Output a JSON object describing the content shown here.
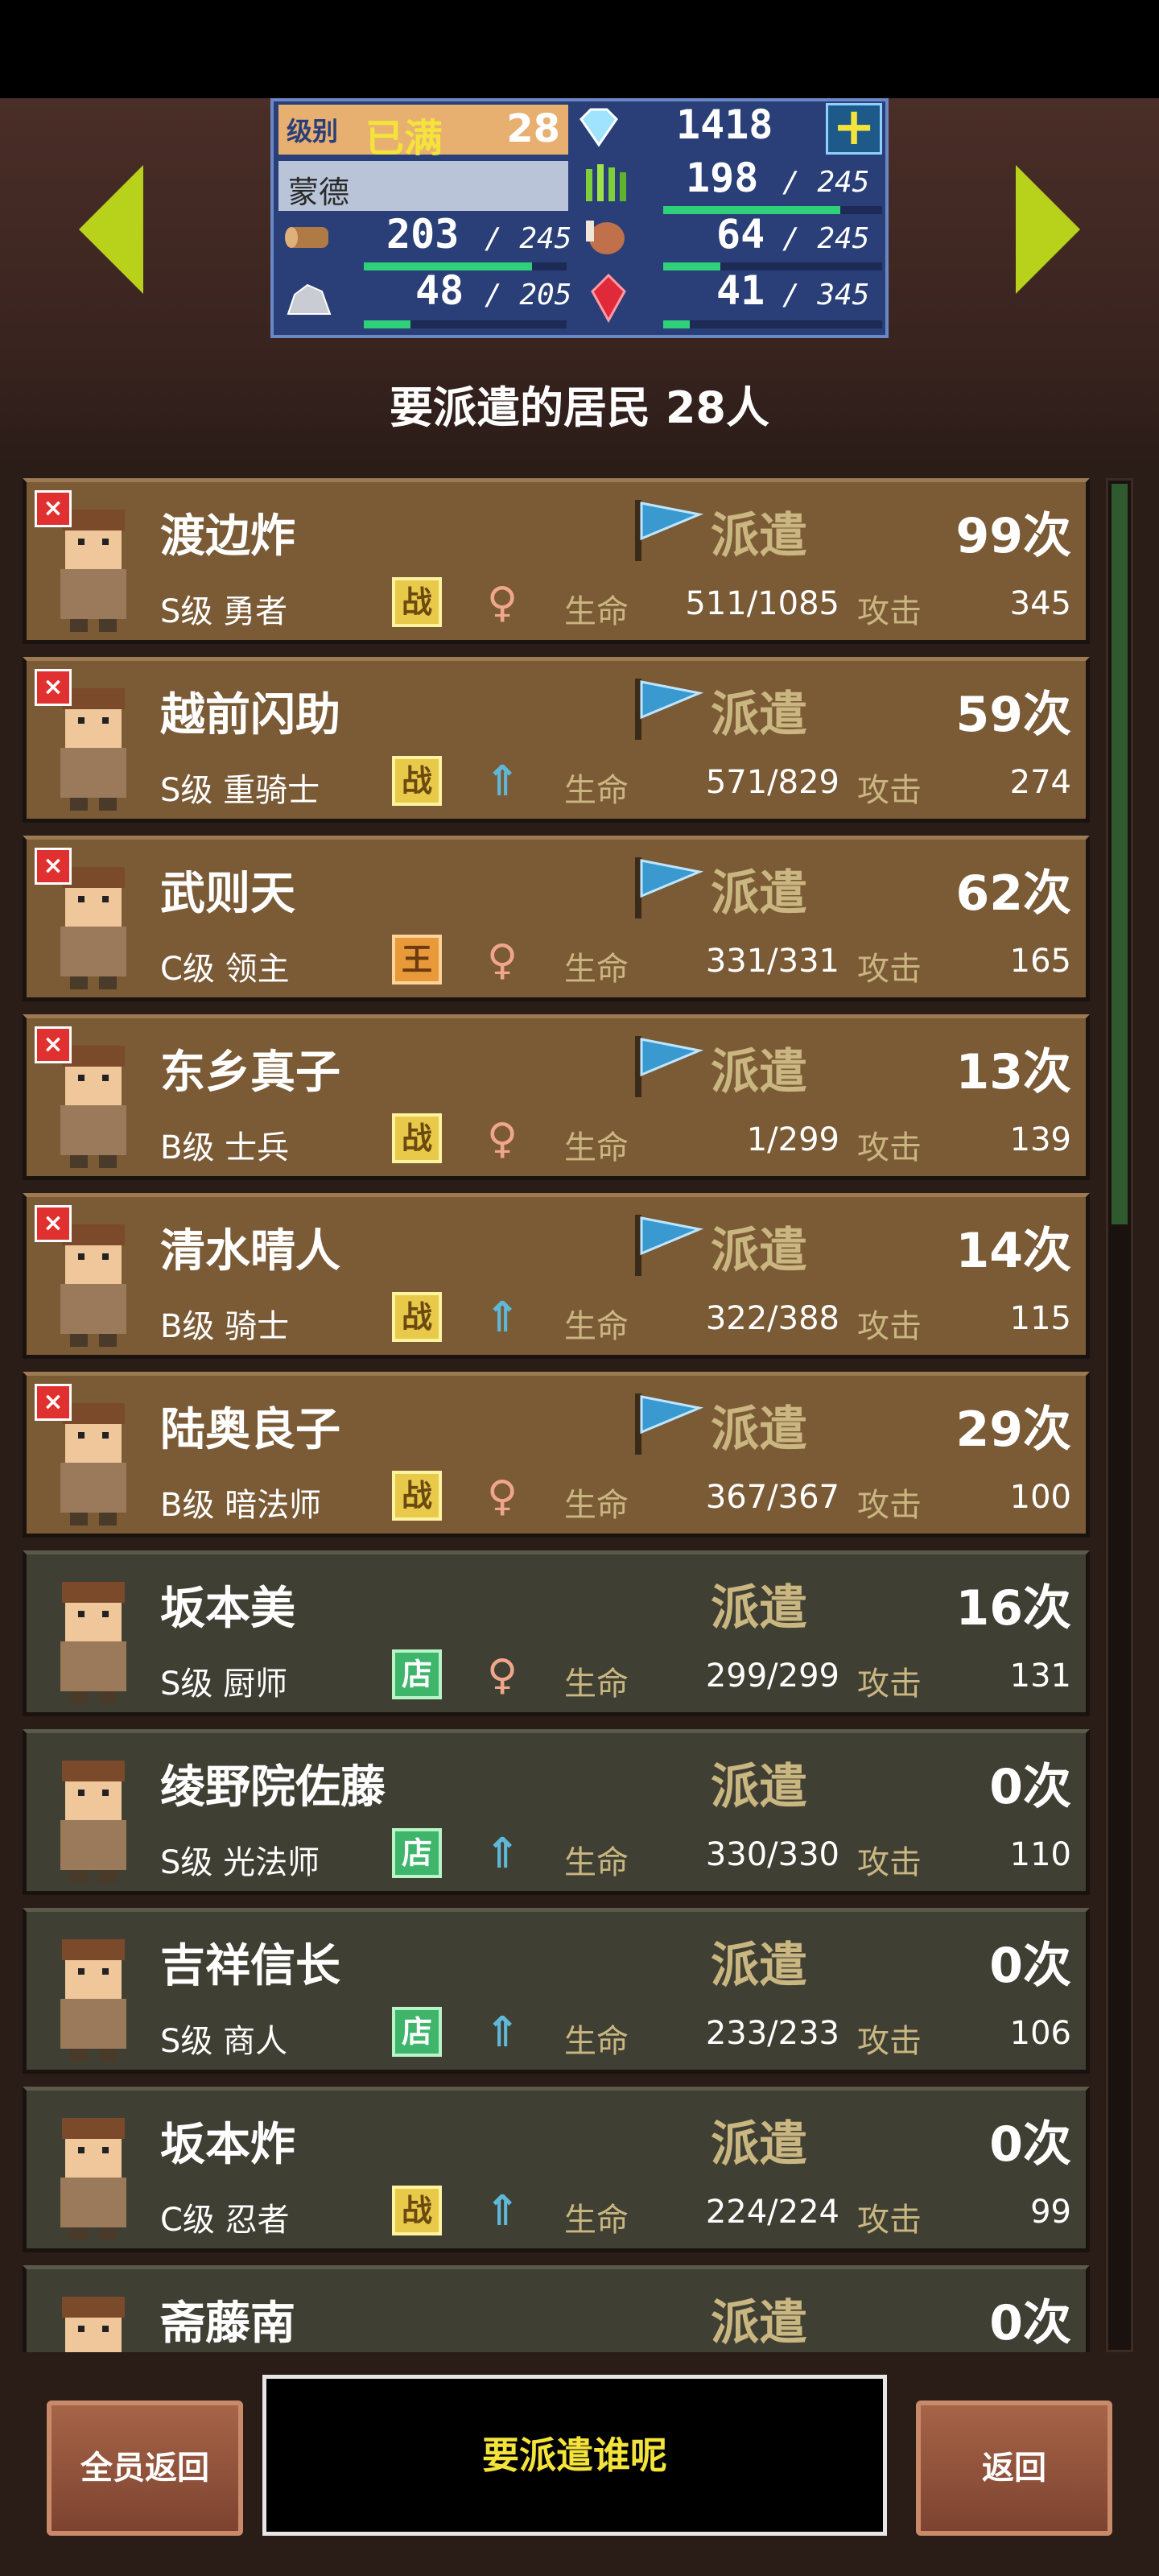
{
  "header": {
    "level_label": "级别",
    "level_status": "已满",
    "level_value": "28",
    "gems": "1418",
    "gem_plus": "+",
    "town_name": "蒙德",
    "resources": [
      {
        "name": "grass",
        "icon": "grass-icon",
        "value": "198",
        "max": "/ 245",
        "fill": 0.81
      },
      {
        "name": "wood",
        "icon": "wood-icon",
        "value": "203",
        "max": "/ 245",
        "fill": 0.83
      },
      {
        "name": "meat",
        "icon": "meat-icon",
        "value": "64",
        "max": "/ 245",
        "fill": 0.26
      },
      {
        "name": "ore",
        "icon": "ore-icon",
        "value": "48",
        "max": "/ 205",
        "fill": 0.23
      },
      {
        "name": "crystal",
        "icon": "crystal-icon",
        "value": "41",
        "max": "/ 345",
        "fill": 0.12
      }
    ]
  },
  "title": "要派遣的居民 28人",
  "labels": {
    "dispatch": "派遣",
    "hp": "生命",
    "attack": "攻击"
  },
  "residents": [
    {
      "name": "渡边炸",
      "grade": "S级 勇者",
      "type": "war",
      "type_label": "战",
      "gender": "f",
      "dispatched": true,
      "count": "99次",
      "hp": "511/1085",
      "atk": "345"
    },
    {
      "name": "越前闪助",
      "grade": "S级 重骑士",
      "type": "war",
      "type_label": "战",
      "gender": "m",
      "dispatched": true,
      "count": "59次",
      "hp": "571/829",
      "atk": "274"
    },
    {
      "name": "武则天",
      "grade": "C级 领主",
      "type": "king",
      "type_label": "王",
      "gender": "f",
      "dispatched": true,
      "count": "62次",
      "hp": "331/331",
      "atk": "165"
    },
    {
      "name": "东乡真子",
      "grade": "B级 士兵",
      "type": "war",
      "type_label": "战",
      "gender": "f",
      "dispatched": true,
      "count": "13次",
      "hp": "1/299",
      "atk": "139"
    },
    {
      "name": "清水晴人",
      "grade": "B级 骑士",
      "type": "war",
      "type_label": "战",
      "gender": "m",
      "dispatched": true,
      "count": "14次",
      "hp": "322/388",
      "atk": "115"
    },
    {
      "name": "陆奥良子",
      "grade": "B级 暗法师",
      "type": "war",
      "type_label": "战",
      "gender": "f",
      "dispatched": true,
      "count": "29次",
      "hp": "367/367",
      "atk": "100"
    },
    {
      "name": "坂本美",
      "grade": "S级 厨师",
      "type": "shop",
      "type_label": "店",
      "gender": "f",
      "dispatched": false,
      "count": "16次",
      "hp": "299/299",
      "atk": "131"
    },
    {
      "name": "绫野院佐藤",
      "grade": "S级 光法师",
      "type": "shop",
      "type_label": "店",
      "gender": "m",
      "dispatched": false,
      "count": "0次",
      "hp": "330/330",
      "atk": "110"
    },
    {
      "name": "吉祥信长",
      "grade": "S级 商人",
      "type": "shop",
      "type_label": "店",
      "gender": "m",
      "dispatched": false,
      "count": "0次",
      "hp": "233/233",
      "atk": "106"
    },
    {
      "name": "坂本炸",
      "grade": "C级 忍者",
      "type": "war",
      "type_label": "战",
      "gender": "m",
      "dispatched": false,
      "count": "0次",
      "hp": "224/224",
      "atk": "99"
    },
    {
      "name": "斋藤南",
      "grade": "",
      "type": "",
      "type_label": "",
      "gender": "",
      "dispatched": false,
      "count": "0次",
      "hp": "",
      "atk": ""
    }
  ],
  "footer": {
    "return_all": "全员返回",
    "message": "要派遣谁呢",
    "back": "返回"
  },
  "colors": {
    "dispatched_row": "#7b5a36",
    "idle_row": "#3f3f33",
    "accent_yellow": "#f4e33a",
    "arrow": "#b8d11a"
  }
}
